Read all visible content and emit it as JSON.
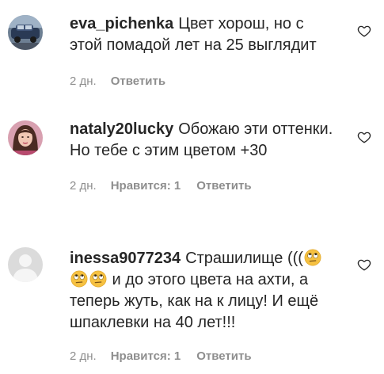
{
  "colors": {
    "text": "#262626",
    "meta": "#8e8e8e",
    "emoji": "#f6c141"
  },
  "comments": [
    {
      "username": "eva_pichenka",
      "text": "Цвет хорош, но с этой помадой лет на 25 выглядит",
      "time": "2 дн.",
      "likes": null,
      "reply": "Ответить",
      "avatar_icon": "avatar-car-photo"
    },
    {
      "username": "nataly20lucky",
      "text": "Обожаю эти оттенки. Но тебе с этим цветом +30",
      "time": "2 дн.",
      "likes": "Нравится: 1",
      "reply": "Ответить",
      "avatar_icon": "avatar-woman-photo"
    },
    {
      "username": "inessa9077234",
      "text_part1": "Страшилище (((",
      "text_part2": " и до этого цвета на ахти, а теперь жуть, как на к лицу! И ещё шпаклевки на 40 лет!!!",
      "emoji_icon": "face-with-rolling-eyes-icon",
      "time": "2 дн.",
      "likes": "Нравится: 1",
      "reply": "Ответить",
      "avatar_icon": "avatar-default-icon"
    }
  ],
  "heart_icon": "heart-outline-icon"
}
